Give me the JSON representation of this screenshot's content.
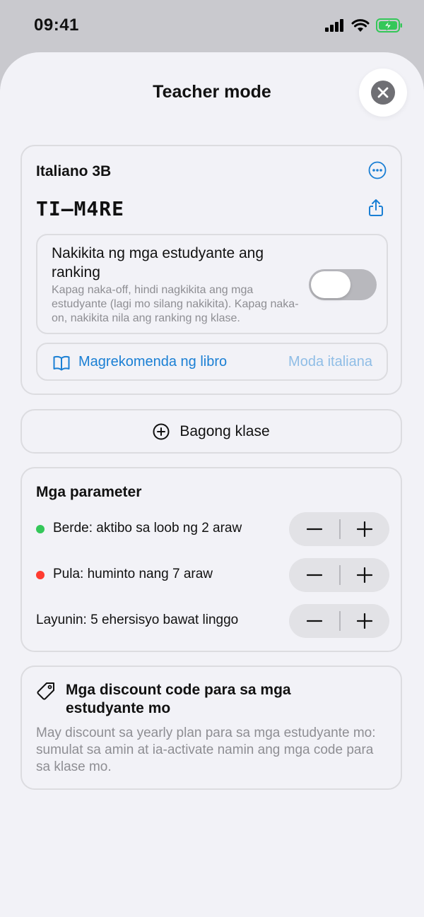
{
  "status_bar": {
    "time": "09:41"
  },
  "header": {
    "title": "Teacher mode"
  },
  "class_card": {
    "class_name": "Italiano 3B",
    "class_code": "TI–M4RE",
    "ranking": {
      "title": "Nakikita ng mga estudyante ang ranking",
      "description": "Kapag naka-off, hindi nagkikita ang mga estudyante (lagi mo silang nakikita). Kapag naka-on, nakikita nila ang ranking ng klase.",
      "enabled": false
    },
    "recommend": {
      "label": "Magrekomenda ng libro",
      "value": "Moda italiana"
    }
  },
  "new_class": {
    "label": "Bagong klase"
  },
  "parameters": {
    "title": "Mga parameter",
    "rows": [
      {
        "label": "Berde: aktibo sa loob ng 2 araw",
        "dot_color": "#34c759"
      },
      {
        "label": "Pula: huminto nang 7 araw",
        "dot_color": "#ff3b30"
      },
      {
        "label": "Layunin: 5 ehersisyo bawat linggo",
        "dot_color": null
      }
    ]
  },
  "discount": {
    "title": "Mga discount code para sa mga estudyante mo",
    "description": "May discount sa yearly plan para sa mga estudyante mo: sumulat sa amin at ia-activate namin ang mga code para sa klase mo."
  },
  "colors": {
    "accent": "#1a7fd4",
    "battery": "#34c759"
  }
}
